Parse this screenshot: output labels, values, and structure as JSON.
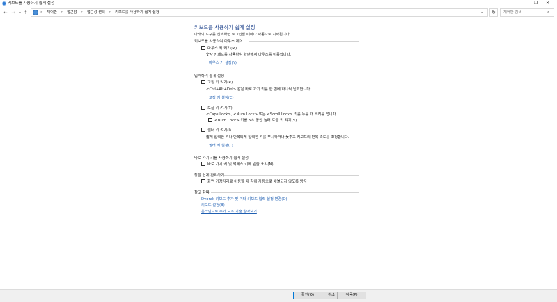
{
  "window": {
    "title": "키보드를 사용하기 쉽게 설정",
    "minimize": "—",
    "maximize": "❐",
    "close": "✕"
  },
  "nav": {
    "back": "←",
    "forward": "→",
    "recent": "⌄",
    "up": "↑"
  },
  "address": {
    "crumbs": [
      "제어판",
      "접근성",
      "접근성 센터",
      "키보드를 사용하기 쉽게 설정"
    ],
    "separator": ">",
    "dropdown": "⌄",
    "refresh": "↻"
  },
  "search": {
    "placeholder": "제어판 검색",
    "icon": "⌕"
  },
  "page": {
    "title": "키보드를 사용하기 쉽게 설정",
    "subtitle": "아래의 도구를 선택하면 로그인할 때마다 자동으로 시작됩니다."
  },
  "mouse_section": {
    "heading": "키보드를 사용하여 마우스 제어",
    "checkbox": "마우스 키 켜기(M)",
    "desc": "숫자 키패드를 사용하여 화면에서 마우스를 이동합니다.",
    "link": "마우스 키 설정(Y)"
  },
  "typing_section": {
    "heading": "입력하기 쉽게 설정",
    "sticky": {
      "checkbox": "고정 키 켜기(R)",
      "desc": "<Ctrl+Alt+Del> 같은 바로 가기 키를 한 번에 하나씩 입력합니다.",
      "link": "고정 키 설정(C)"
    },
    "toggle": {
      "checkbox": "토글 키 켜기(T)",
      "desc": "<Caps Lock>, <Num Lock> 또는 <Scroll Lock> 키를 누를 때 소리를 냅니다.",
      "sub_checkbox": "<Num Lock> 키를 5초 동안 눌러 토글 키 켜기(S)"
    },
    "filter": {
      "checkbox": "필터 키 켜기(I)",
      "desc": "짧게 입력한 키나 반복되게 입력한 키를 무시하거나 늦추고 키보드의 반복 속도를 조정합니다.",
      "link": "필터 키 설정(L)"
    }
  },
  "shortcut_section": {
    "heading": "바로 가기 키를 사용하기 쉽게 설정",
    "checkbox": "바로 가기 키 및 액세스 키에 밑줄 표시(N)"
  },
  "window_section": {
    "heading": "창을 쉽게 관리하기",
    "checkbox": "화면 가장자리로 이동할 때 창이 자동으로 배열되지 않도록 방지"
  },
  "see_also": {
    "heading": "참고 항목",
    "links": [
      "Dvorak 키보드 추가 및 기타 키보드 입력 설정 변경(O)",
      "키보드 설정(B)",
      "온라인으로 추가 보조 기술 알아보기"
    ]
  },
  "footer": {
    "ok": "확인(O)",
    "cancel": "취소",
    "apply": "적용(P)"
  }
}
